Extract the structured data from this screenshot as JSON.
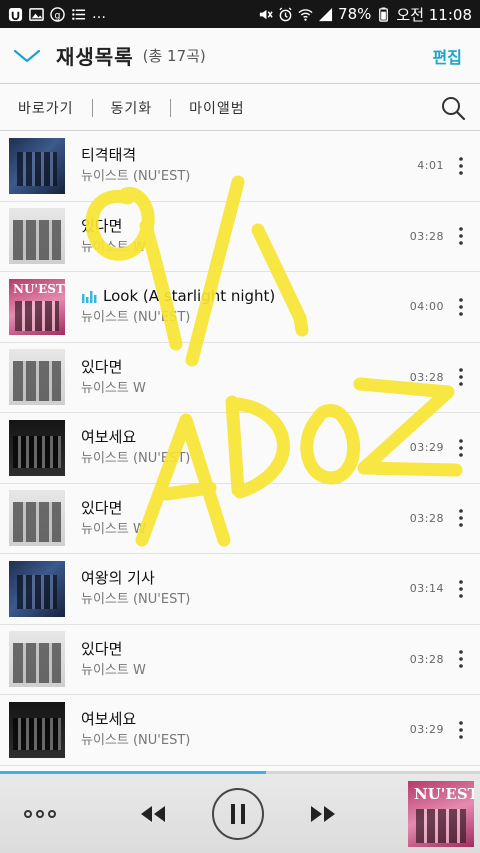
{
  "status_bar": {
    "notif_left": "…",
    "battery": "78%",
    "time": "오전 11:08"
  },
  "header": {
    "title": "재생목록",
    "count": "(총 17곡)",
    "edit": "편집"
  },
  "toolbar": {
    "items": [
      "바로가기",
      "동기화",
      "마이앨범"
    ]
  },
  "songs": [
    {
      "title": "티격태격",
      "artist": "뉴이스트 (NU'EST)",
      "duration": "4:01",
      "art": "dark"
    },
    {
      "title": "있다면",
      "artist": "뉴이스트 W",
      "duration": "03:28",
      "art": "grey"
    },
    {
      "title": "Look (A starlight night)",
      "artist": "뉴이스트 (NU'EST)",
      "duration": "04:00",
      "art": "pink",
      "album_logo": "NU'EST",
      "playing": true
    },
    {
      "title": "있다면",
      "artist": "뉴이스트 W",
      "duration": "03:28",
      "art": "grey"
    },
    {
      "title": "여보세요",
      "artist": "뉴이스트 (NU'EST)",
      "duration": "03:29",
      "art": "black"
    },
    {
      "title": "있다면",
      "artist": "뉴이스트 W",
      "duration": "03:28",
      "art": "grey"
    },
    {
      "title": "여왕의 기사",
      "artist": "뉴이스트 (NU'EST)",
      "duration": "03:14",
      "art": "dark"
    },
    {
      "title": "있다면",
      "artist": "뉴이스트 W",
      "duration": "03:28",
      "art": "grey"
    },
    {
      "title": "여보세요",
      "artist": "뉴이스트 (NU'EST)",
      "duration": "03:29",
      "art": "black"
    }
  ],
  "player": {
    "progress": 0.555,
    "album_logo": "NU'EST"
  },
  "overlay_handwriting": {
    "lines": [
      "9/1",
      "ADOZ"
    ],
    "color": "#f7e433"
  },
  "colors": {
    "accent": "#1ba5c9",
    "progress": "#3cb4e0"
  }
}
